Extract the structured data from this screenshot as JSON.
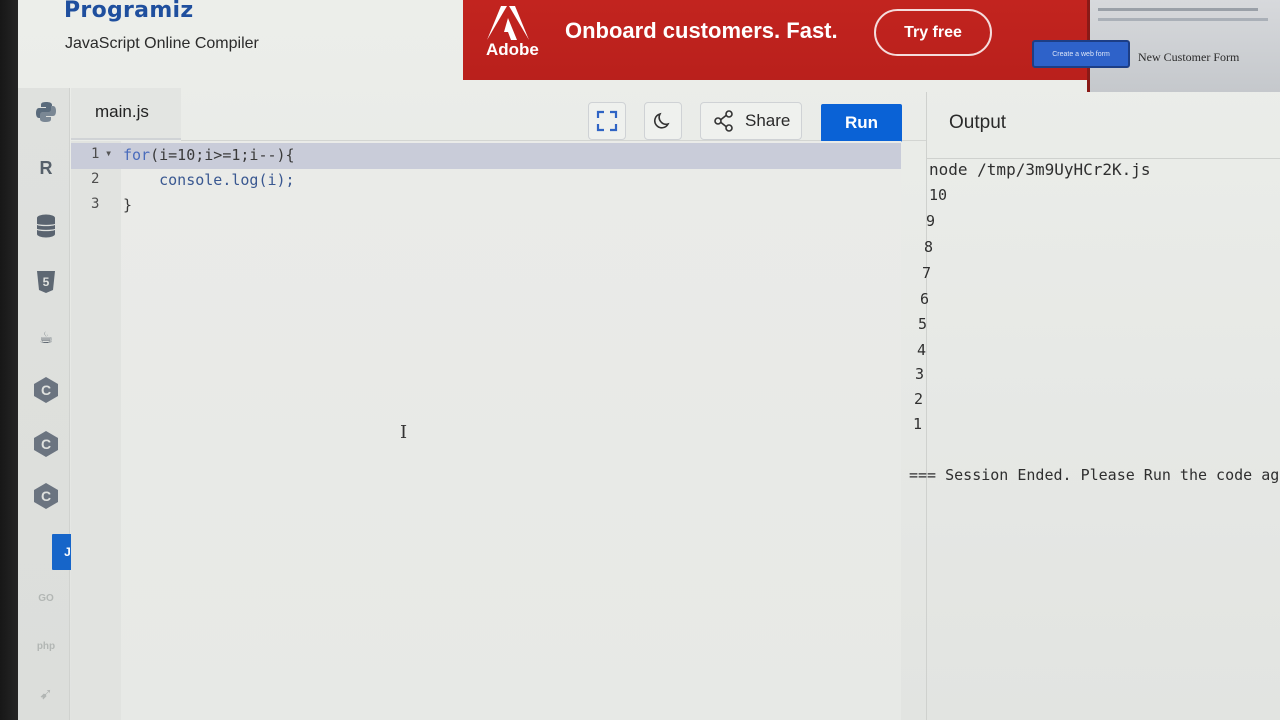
{
  "header": {
    "logo": "Programiz",
    "subtitle": "JavaScript Online Compiler"
  },
  "ad": {
    "brand": "Adobe",
    "headline": "Onboard customers. Fast.",
    "cta": "Try free",
    "side_pill": "Create a web form",
    "side_title": "New Customer Form"
  },
  "sidebar": {
    "items": [
      {
        "name": "python-icon",
        "glyph": ""
      },
      {
        "name": "r-icon",
        "glyph": "R"
      },
      {
        "name": "database-icon",
        "glyph": ""
      },
      {
        "name": "html5-icon",
        "glyph": "5"
      },
      {
        "name": "java-icon",
        "glyph": "☕"
      },
      {
        "name": "c-icon",
        "glyph": "C"
      },
      {
        "name": "cpp-icon",
        "glyph": "C"
      },
      {
        "name": "csharp-icon",
        "glyph": "C"
      },
      {
        "name": "js-icon",
        "glyph": "JS"
      },
      {
        "name": "go-icon",
        "glyph": "GO"
      },
      {
        "name": "php-icon",
        "glyph": "php"
      },
      {
        "name": "swift-icon",
        "glyph": "➹"
      }
    ]
  },
  "editor": {
    "tab": "main.js",
    "share_label": "Share",
    "run_label": "Run",
    "lines": [
      {
        "n": "1",
        "kw": "for",
        "text": "(i=10;i>=1;i--){"
      },
      {
        "n": "2",
        "kw": "",
        "text": "    console.log(i);"
      },
      {
        "n": "3",
        "kw": "",
        "text": "}"
      }
    ]
  },
  "output": {
    "title": "Output",
    "command": "node /tmp/3m9UyHCr2K.js",
    "values": [
      "10",
      "9",
      "8",
      "7",
      "6",
      "5",
      "4",
      "3",
      "2",
      "1"
    ],
    "end": "=== Session Ended. Please Run the code again ==="
  }
}
